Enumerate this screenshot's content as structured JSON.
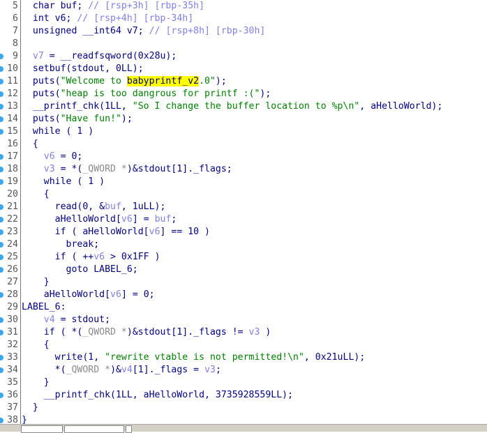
{
  "editor": {
    "lines": [
      {
        "n": "5",
        "bp": false,
        "tokens": [
          [
            "c",
            "  char buf; "
          ],
          [
            "m",
            "// [rsp+3h] [rbp-35h]"
          ]
        ]
      },
      {
        "n": "6",
        "bp": false,
        "tokens": [
          [
            "c",
            "  int v6; "
          ],
          [
            "m",
            "// [rsp+4h] [rbp-34h]"
          ]
        ]
      },
      {
        "n": "7",
        "bp": false,
        "tokens": [
          [
            "c",
            "  unsigned __int64 v7; "
          ],
          [
            "m",
            "// [rsp+8h] [rbp-30h]"
          ]
        ]
      },
      {
        "n": "8",
        "bp": false,
        "tokens": []
      },
      {
        "n": "9",
        "bp": true,
        "tokens": [
          [
            "c",
            "  "
          ],
          [
            "v",
            "v7"
          ],
          [
            "c",
            " = __readfsqword(0x28u);"
          ]
        ]
      },
      {
        "n": "10",
        "bp": true,
        "tokens": [
          [
            "c",
            "  setbuf(stdout, 0LL);"
          ]
        ]
      },
      {
        "n": "11",
        "bp": true,
        "tokens": [
          [
            "c",
            "  puts("
          ],
          [
            "s",
            "\"Welcome to "
          ],
          [
            "h",
            "babyprintf_v2"
          ],
          [
            "s",
            ".0\""
          ],
          [
            "c",
            ");"
          ]
        ]
      },
      {
        "n": "12",
        "bp": true,
        "tokens": [
          [
            "c",
            "  puts("
          ],
          [
            "s",
            "\"heap is too dangrous for printf :(\""
          ],
          [
            "c",
            ");"
          ]
        ]
      },
      {
        "n": "13",
        "bp": true,
        "tokens": [
          [
            "c",
            "  __printf_chk(1LL, "
          ],
          [
            "s",
            "\"So I change the buffer location to %p\\n\""
          ],
          [
            "c",
            ", aHelloWorld);"
          ]
        ]
      },
      {
        "n": "14",
        "bp": true,
        "tokens": [
          [
            "c",
            "  puts("
          ],
          [
            "s",
            "\"Have fun!\""
          ],
          [
            "c",
            ");"
          ]
        ]
      },
      {
        "n": "15",
        "bp": true,
        "tokens": [
          [
            "c",
            "  while ( 1 )"
          ]
        ]
      },
      {
        "n": "16",
        "bp": false,
        "tokens": [
          [
            "c",
            "  {"
          ]
        ]
      },
      {
        "n": "17",
        "bp": true,
        "tokens": [
          [
            "c",
            "    "
          ],
          [
            "v",
            "v6"
          ],
          [
            "c",
            " = 0;"
          ]
        ]
      },
      {
        "n": "18",
        "bp": true,
        "tokens": [
          [
            "c",
            "    "
          ],
          [
            "v",
            "v3"
          ],
          [
            "c",
            " = *("
          ],
          [
            "t",
            "_QWORD *"
          ],
          [
            "c",
            ")&stdout[1]._flags;"
          ]
        ]
      },
      {
        "n": "19",
        "bp": true,
        "tokens": [
          [
            "c",
            "    while ( 1 )"
          ]
        ]
      },
      {
        "n": "20",
        "bp": false,
        "tokens": [
          [
            "c",
            "    {"
          ]
        ]
      },
      {
        "n": "21",
        "bp": true,
        "tokens": [
          [
            "c",
            "      read(0, &"
          ],
          [
            "v",
            "buf"
          ],
          [
            "c",
            ", 1uLL);"
          ]
        ]
      },
      {
        "n": "22",
        "bp": true,
        "tokens": [
          [
            "c",
            "      aHelloWorld["
          ],
          [
            "v",
            "v6"
          ],
          [
            "c",
            "] = "
          ],
          [
            "v",
            "buf"
          ],
          [
            "c",
            ";"
          ]
        ]
      },
      {
        "n": "23",
        "bp": true,
        "tokens": [
          [
            "c",
            "      if ( aHelloWorld["
          ],
          [
            "v",
            "v6"
          ],
          [
            "c",
            "] == 10 )"
          ]
        ]
      },
      {
        "n": "24",
        "bp": true,
        "tokens": [
          [
            "c",
            "        break;"
          ]
        ]
      },
      {
        "n": "25",
        "bp": true,
        "tokens": [
          [
            "c",
            "      if ( ++"
          ],
          [
            "v",
            "v6"
          ],
          [
            "c",
            " > 0x1FF )"
          ]
        ]
      },
      {
        "n": "26",
        "bp": true,
        "tokens": [
          [
            "c",
            "        goto LABEL_6;"
          ]
        ]
      },
      {
        "n": "27",
        "bp": false,
        "tokens": [
          [
            "c",
            "    }"
          ]
        ]
      },
      {
        "n": "28",
        "bp": true,
        "tokens": [
          [
            "c",
            "    aHelloWorld["
          ],
          [
            "v",
            "v6"
          ],
          [
            "c",
            "] = 0;"
          ]
        ]
      },
      {
        "n": "29",
        "bp": false,
        "tokens": [
          [
            "c",
            "LABEL_6:"
          ]
        ]
      },
      {
        "n": "30",
        "bp": true,
        "tokens": [
          [
            "c",
            "    "
          ],
          [
            "v",
            "v4"
          ],
          [
            "c",
            " = stdout;"
          ]
        ]
      },
      {
        "n": "31",
        "bp": true,
        "tokens": [
          [
            "c",
            "    if ( *("
          ],
          [
            "t",
            "_QWORD *"
          ],
          [
            "c",
            ")&stdout[1]._flags != "
          ],
          [
            "v",
            "v3"
          ],
          [
            "c",
            " )"
          ]
        ]
      },
      {
        "n": "32",
        "bp": false,
        "tokens": [
          [
            "c",
            "    {"
          ]
        ]
      },
      {
        "n": "33",
        "bp": true,
        "tokens": [
          [
            "c",
            "      write(1, "
          ],
          [
            "s",
            "\"rewrite vtable is not permitted!\\n\""
          ],
          [
            "c",
            ", 0x21uLL);"
          ]
        ]
      },
      {
        "n": "34",
        "bp": true,
        "tokens": [
          [
            "c",
            "      *("
          ],
          [
            "t",
            "_QWORD *"
          ],
          [
            "c",
            ")&"
          ],
          [
            "v",
            "v4"
          ],
          [
            "c",
            "[1]._flags = "
          ],
          [
            "v",
            "v3"
          ],
          [
            "c",
            ";"
          ]
        ]
      },
      {
        "n": "35",
        "bp": false,
        "tokens": [
          [
            "c",
            "    }"
          ]
        ]
      },
      {
        "n": "36",
        "bp": true,
        "tokens": [
          [
            "c",
            "    __printf_chk(1LL, aHelloWorld, 3735928559LL);"
          ]
        ]
      },
      {
        "n": "37",
        "bp": false,
        "tokens": [
          [
            "c",
            "  }"
          ]
        ]
      },
      {
        "n": "38",
        "bp": true,
        "tokens": [
          [
            "c",
            "}"
          ]
        ]
      }
    ]
  },
  "colors": {
    "code": "#000080",
    "string": "#008000",
    "local_var": "#8080e0",
    "type": "#8a8a8a",
    "highlight": "#ffff00",
    "breakpoint_dot": "#3aa8f0"
  }
}
